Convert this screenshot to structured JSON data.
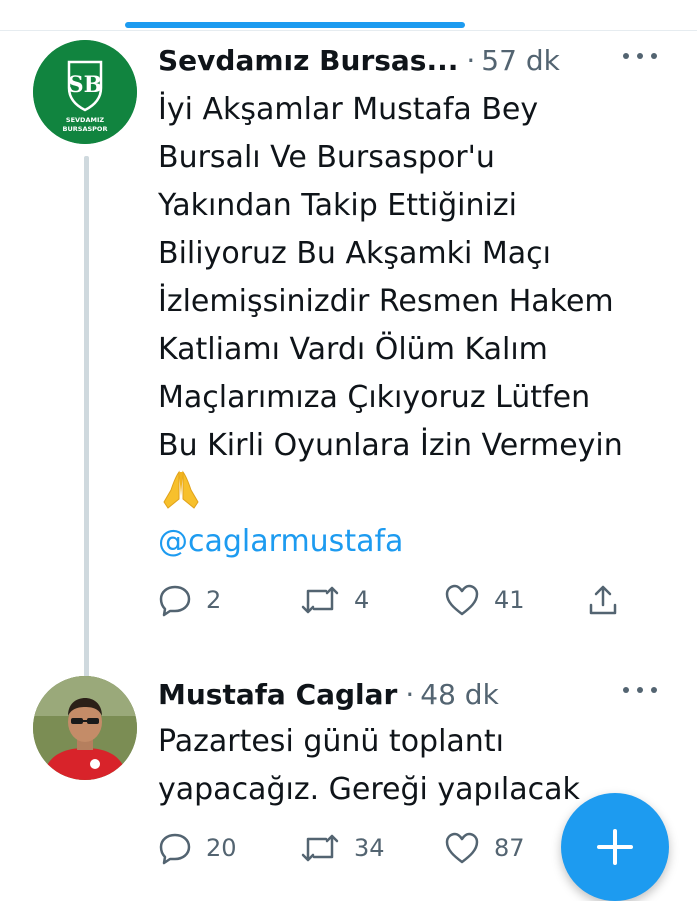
{
  "tweets": [
    {
      "author": "Sevdamız Bursas...",
      "time": "57 dk",
      "text": "İyi Akşamlar Mustafa Bey\nBursalı Ve Bursaspor'u\nYakından Takip Ettiğinizi\nBiliyoruz Bu Akşamki Maçı\nİzlemişsinizdir Resmen Hakem\nKatliamı  Vardı  Ölüm Kalım\nMaçlarımıza Çıkıyoruz Lütfen\nBu Kirli Oyunlara İzin Vermeyin",
      "emoji": "🙏",
      "mention": "@caglarmustafa",
      "avatar_logo": {
        "initials": "SB",
        "line1": "SEVDAMIZ",
        "line2": "BURSASPOR"
      },
      "replies": "2",
      "retweets": "4",
      "likes": "41"
    },
    {
      "author": "Mustafa Caglar",
      "time": "48 dk",
      "text": "Pazartesi günü toplantı\nyapacağız. Gereği yapılacak",
      "replies": "20",
      "retweets": "34",
      "likes": "87"
    }
  ],
  "separator": "·",
  "icons": [
    "more-icon",
    "reply-icon",
    "retweet-icon",
    "like-icon",
    "share-icon",
    "compose-plus-icon"
  ],
  "colors": {
    "accent": "#1d9bf0",
    "club_green": "#11843f",
    "secondary_text": "#536471"
  }
}
